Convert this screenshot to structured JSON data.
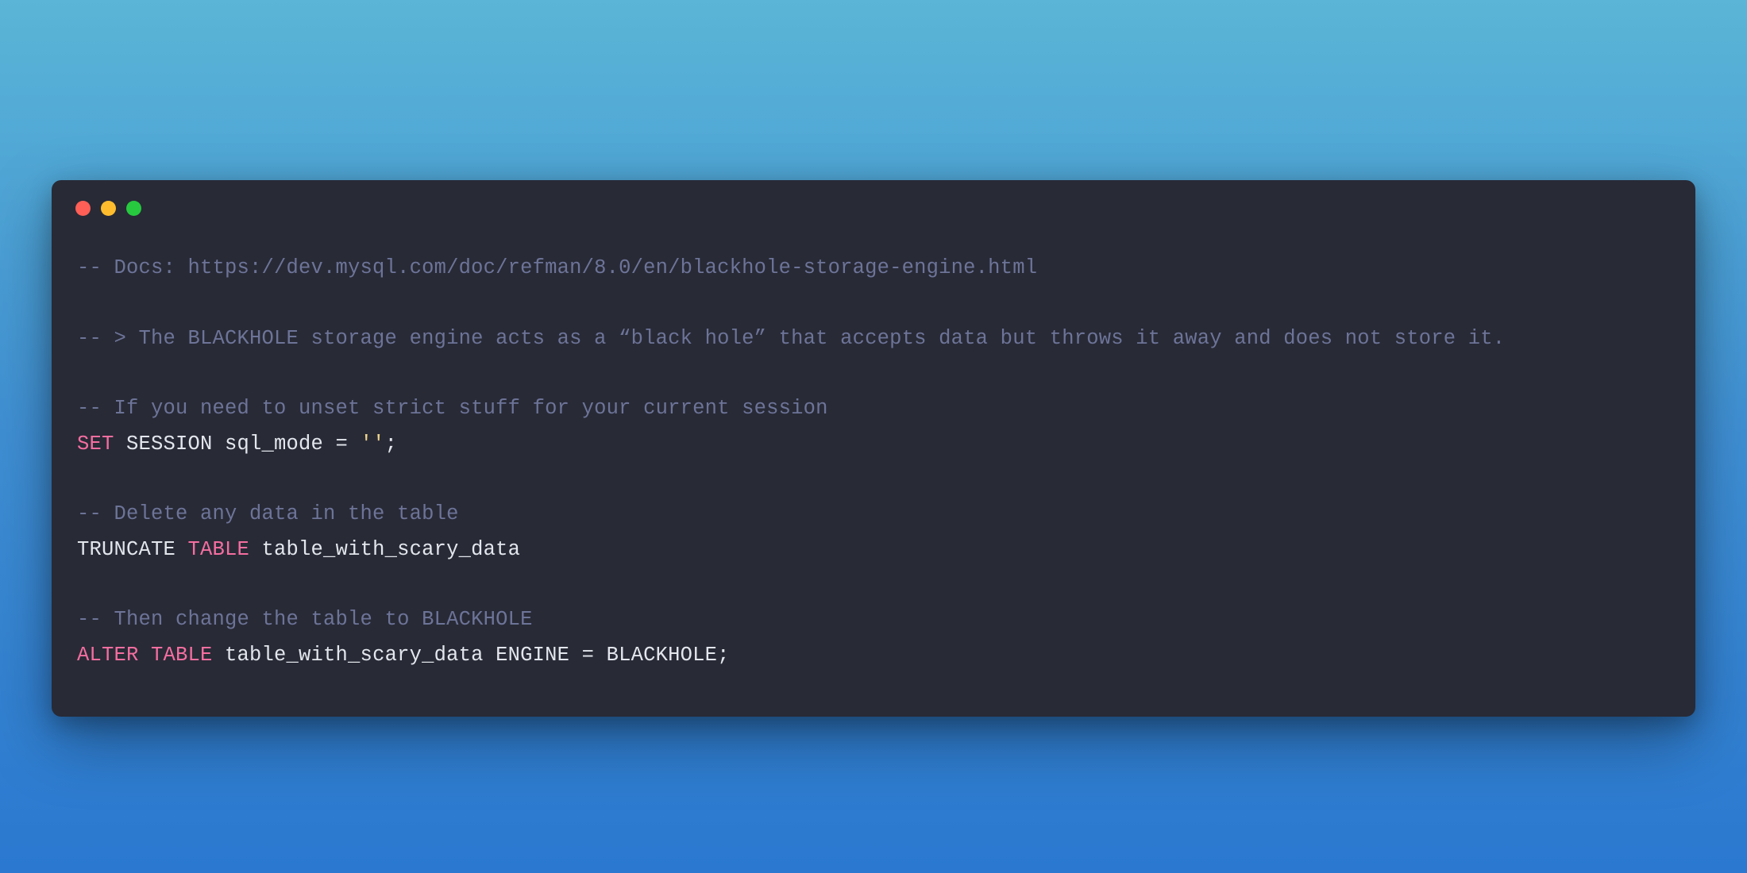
{
  "window": {
    "buttons": [
      "close",
      "minimize",
      "zoom"
    ]
  },
  "code": {
    "tokens": [
      {
        "c": "comment",
        "t": "-- Docs: https://dev.mysql.com/doc/refman/8.0/en/blackhole-storage-engine.html"
      },
      {
        "c": "plain",
        "t": "\n\n"
      },
      {
        "c": "comment",
        "t": "-- > The BLACKHOLE storage engine acts as a “black hole” that accepts data but throws it away and does not store it."
      },
      {
        "c": "plain",
        "t": "\n\n"
      },
      {
        "c": "comment",
        "t": "-- If you need to unset strict stuff for your current session"
      },
      {
        "c": "plain",
        "t": "\n"
      },
      {
        "c": "keyword-pink",
        "t": "SET"
      },
      {
        "c": "plain",
        "t": " SESSION sql_mode = "
      },
      {
        "c": "string",
        "t": "''"
      },
      {
        "c": "plain",
        "t": ";"
      },
      {
        "c": "plain",
        "t": "\n\n"
      },
      {
        "c": "comment",
        "t": "-- Delete any data in the table"
      },
      {
        "c": "plain",
        "t": "\n"
      },
      {
        "c": "plain",
        "t": "TRUNCATE "
      },
      {
        "c": "keyword-pink",
        "t": "TABLE"
      },
      {
        "c": "plain",
        "t": " table_with_scary_data"
      },
      {
        "c": "plain",
        "t": "\n\n"
      },
      {
        "c": "comment",
        "t": "-- Then change the table to BLACKHOLE"
      },
      {
        "c": "plain",
        "t": "\n"
      },
      {
        "c": "keyword-pink",
        "t": "ALTER TABLE"
      },
      {
        "c": "plain",
        "t": " table_with_scary_data ENGINE = BLACKHOLE;"
      }
    ]
  }
}
